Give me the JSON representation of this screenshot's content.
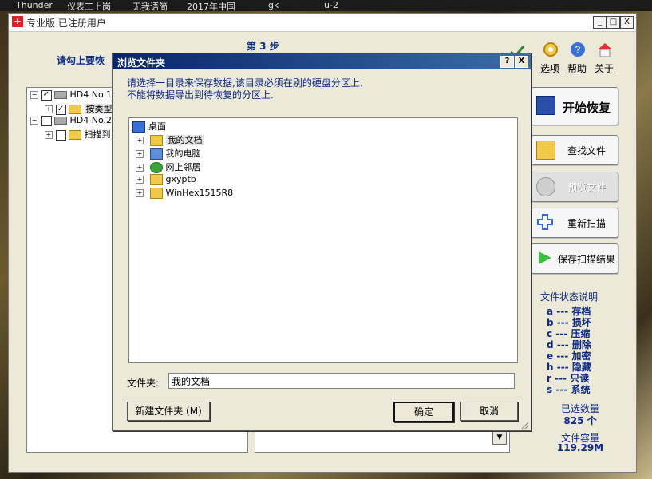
{
  "top_taskbar": [
    "Thunder",
    "仪表工上岗",
    "无我语简",
    "2017年中国",
    "gk",
    "u-2"
  ],
  "window": {
    "title": "专业版  已注册用户",
    "step": "第 3 步",
    "instruction": "请勾上要恢",
    "controls": [
      "_",
      "□",
      "X"
    ]
  },
  "tree": [
    {
      "label": "HD4 No.1 [",
      "checked": true,
      "expanded": true
    },
    {
      "label": "按类型",
      "checked": true
    },
    {
      "label": "HD4 No.2 [",
      "checked": false,
      "expanded": true
    },
    {
      "label": "扫描到",
      "checked": false
    }
  ],
  "right_top": {
    "options": "选项",
    "help": "帮助",
    "about": "关于"
  },
  "buttons": {
    "start_recover": "开始恢复",
    "find_file": "查找文件",
    "preview_file": "预览文件",
    "rescan": "重新扫描",
    "save_scan": "保存扫描结果"
  },
  "legend": {
    "title": "文件状态说明",
    "items": [
      {
        "code": "a",
        "desc": "存档"
      },
      {
        "code": "b",
        "desc": "损坏"
      },
      {
        "code": "c",
        "desc": "压缩"
      },
      {
        "code": "d",
        "desc": "删除"
      },
      {
        "code": "e",
        "desc": "加密"
      },
      {
        "code": "h",
        "desc": "隐藏"
      },
      {
        "code": "r",
        "desc": "只读"
      },
      {
        "code": "s",
        "desc": "系统"
      }
    ]
  },
  "stats": {
    "selected_label": "已选数量",
    "selected_value": "825 个",
    "size_label": "文件容量",
    "size_value": "119.29M"
  },
  "dialog": {
    "title": "浏览文件夹",
    "help_btn": "?",
    "close_btn": "X",
    "instruction_line1": "请选择一目录来保存数据,该目录必须在别的硬盘分区上.",
    "instruction_line2": "不能将数据导出到待恢复的分区上.",
    "root": "桌面",
    "items": [
      "我的文档",
      "我的电脑",
      "网上邻居",
      "gxyptb",
      "WinHex1515R8"
    ],
    "folder_label": "文件夹:",
    "folder_value": "我的文档",
    "new_folder": "新建文件夹 (M)",
    "ok": "确定",
    "cancel": "取消"
  }
}
